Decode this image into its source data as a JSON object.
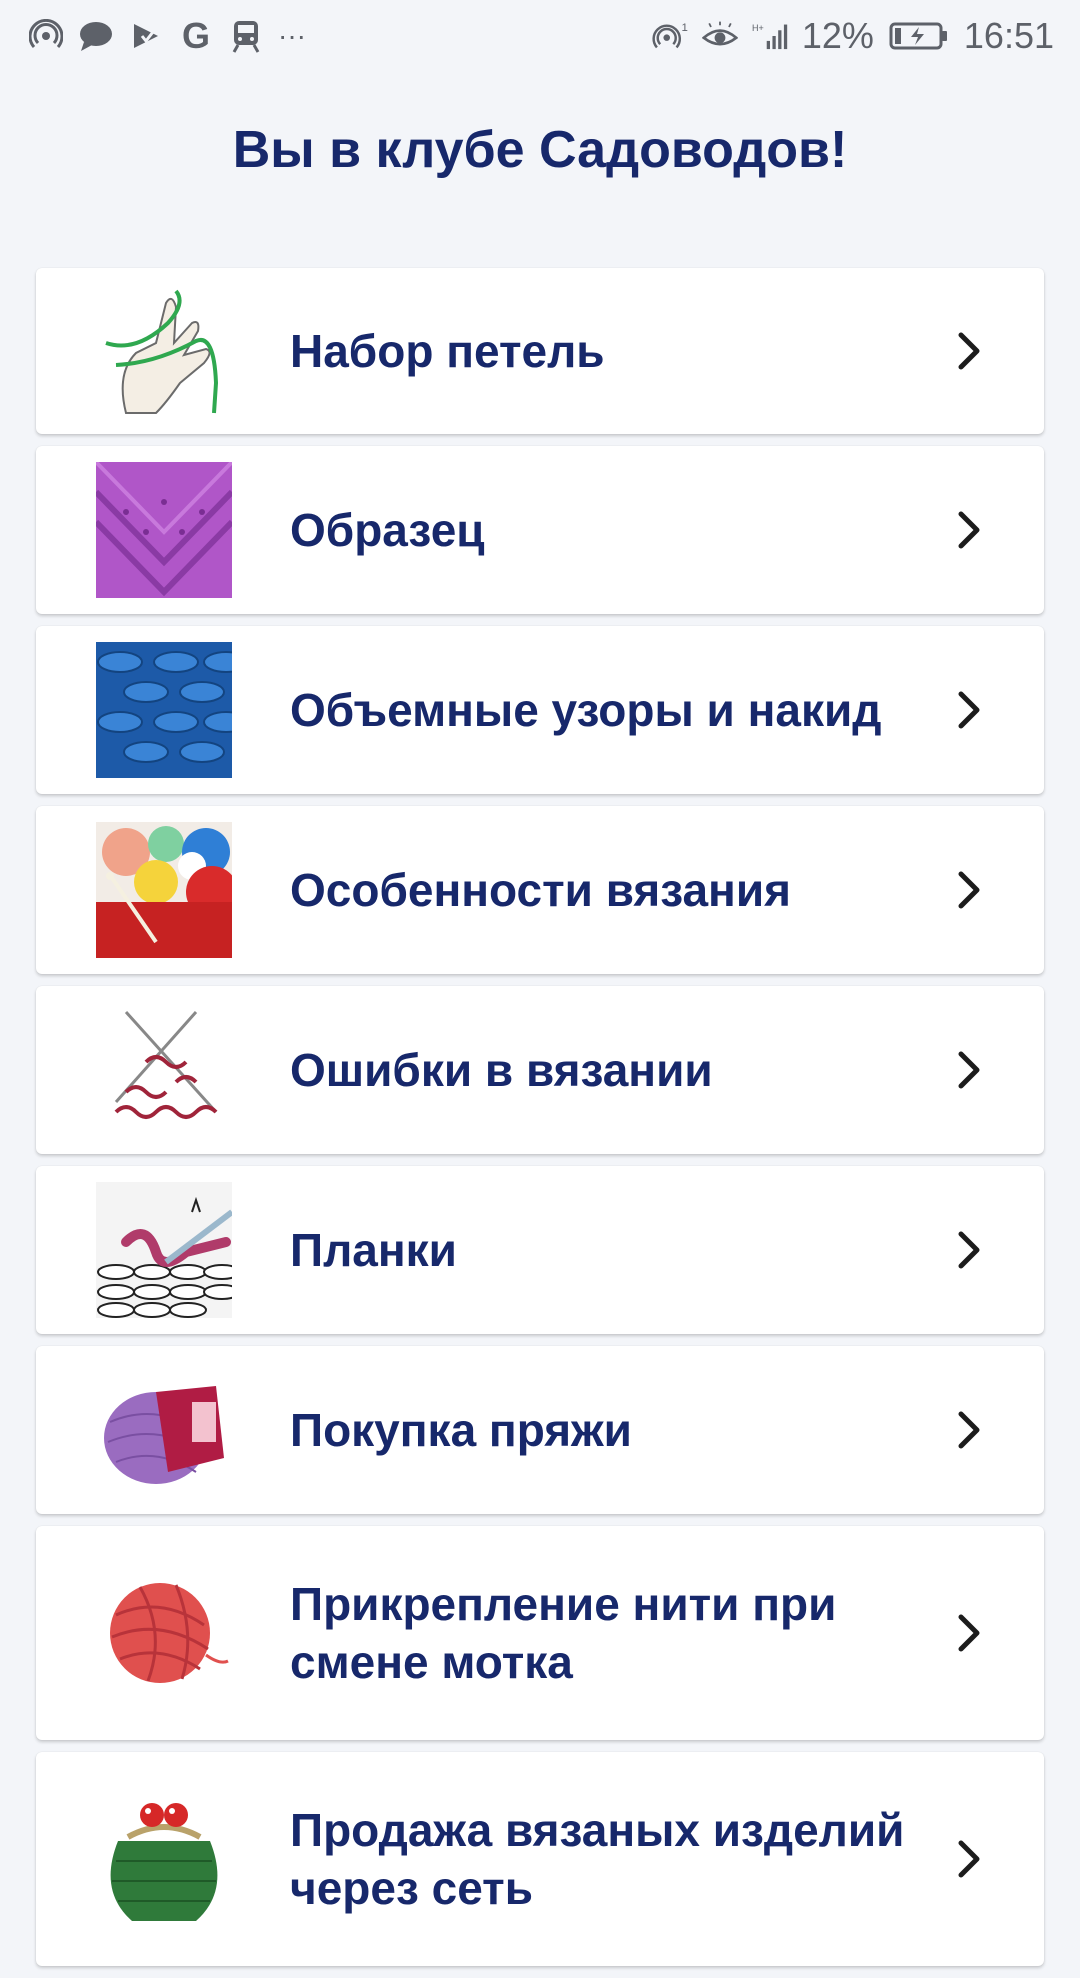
{
  "status_bar": {
    "battery_percent": "12%",
    "time": "16:51",
    "dots": "···",
    "g_letter": "G"
  },
  "header": {
    "title": "Вы в клубе Садоводов!"
  },
  "menu": {
    "items": [
      {
        "label": "Набор петель",
        "icon": "hand-cast-on-thumbnail"
      },
      {
        "label": "Образец",
        "icon": "purple-knit-swatch-thumbnail"
      },
      {
        "label": "Объемные узоры и накид",
        "icon": "blue-cable-knit-thumbnail"
      },
      {
        "label": "Особенности вязания",
        "icon": "yarn-balls-thumbnail"
      },
      {
        "label": "Ошибки в вязании",
        "icon": "knitting-needles-diagram-thumbnail"
      },
      {
        "label": "Планки",
        "icon": "crochet-diagram-thumbnail"
      },
      {
        "label": "Покупка пряжи",
        "icon": "purple-yarn-skein-thumbnail"
      },
      {
        "label": "Прикрепление нити при смене мотка",
        "icon": "red-yarn-ball-thumbnail"
      },
      {
        "label": "Продажа вязаных изделий через сеть",
        "icon": "knitted-purse-thumbnail"
      }
    ]
  },
  "colors": {
    "title": "#17286b",
    "background": "#f3f5f9",
    "card": "#ffffff",
    "chevron": "#1c1c1c"
  }
}
